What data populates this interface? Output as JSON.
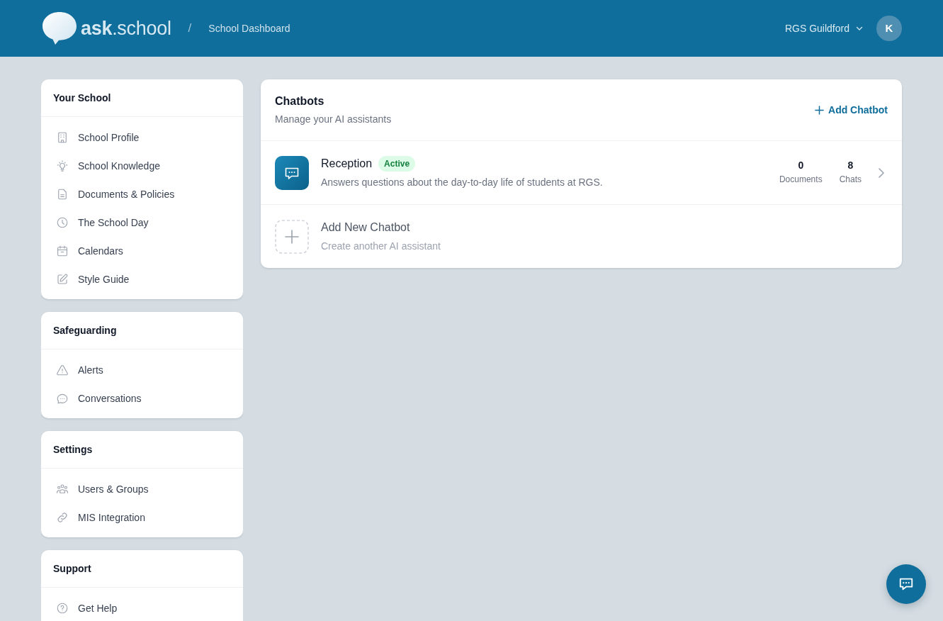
{
  "header": {
    "logo": "**ask**.school",
    "separator": "/",
    "breadcrumb": "School Dashboard",
    "school": "RGS Guildford",
    "avatar_initial": "K"
  },
  "sidebar": {
    "sections": [
      {
        "title": "Your School",
        "items": [
          "School Profile",
          "School Knowledge",
          "Documents & Policies",
          "The School Day",
          "Calendars",
          "Style Guide"
        ]
      },
      {
        "title": "Safeguarding",
        "items": [
          "Alerts",
          "Conversations"
        ]
      },
      {
        "title": "Settings",
        "items": [
          "Users & Groups",
          "MIS Integration"
        ]
      },
      {
        "title": "Support",
        "items": [
          "Get Help"
        ]
      }
    ]
  },
  "chatbots": {
    "title": "Chatbots",
    "subtitle": "Manage your AI assistants",
    "add_button": "Add Chatbot",
    "rows": [
      {
        "kind": "chatbot",
        "name": "Reception",
        "status": "Active",
        "description": "Answers questions about the day-to-day life of students at RGS.",
        "stats": [
          {
            "value": "0",
            "label": "Documents"
          },
          {
            "value": "8",
            "label": "Chats"
          }
        ]
      },
      {
        "kind": "add",
        "name": "Add New Chatbot",
        "description": "Create another AI assistant"
      }
    ]
  }
}
